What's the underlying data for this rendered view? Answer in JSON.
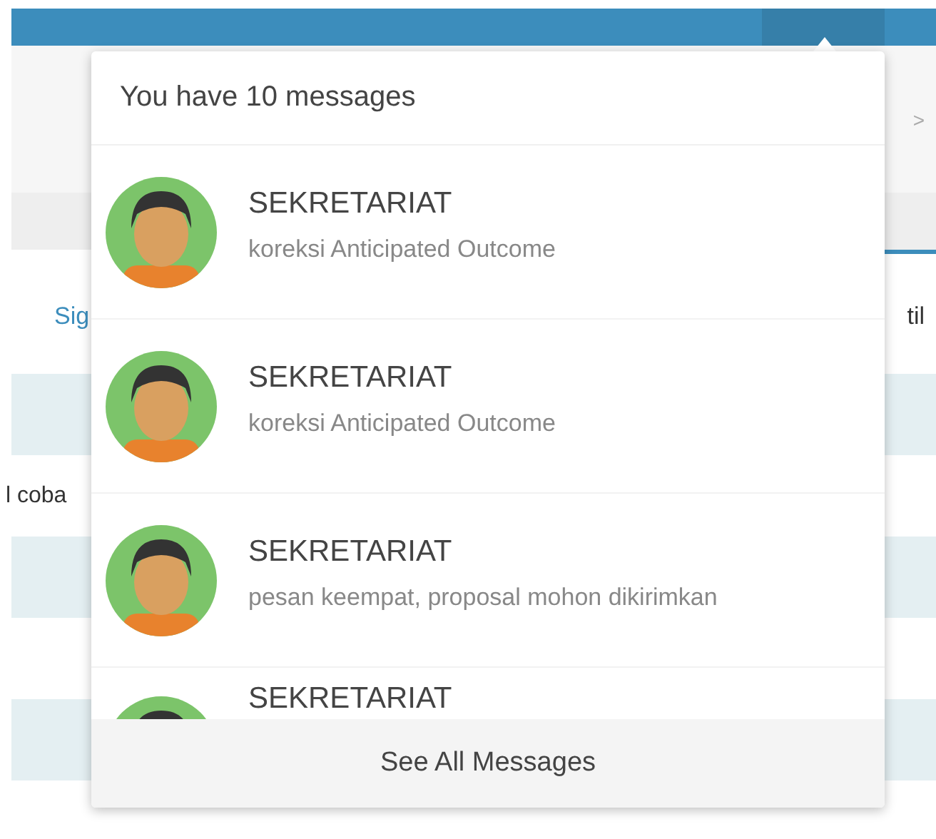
{
  "page": {
    "breadcrumb_separator": ">",
    "tabs": [
      "Sig",
      "til"
    ],
    "table_cell": "l coba"
  },
  "messages_dropdown": {
    "header": "You have 10 messages",
    "messages": [
      {
        "sender": "SEKRETARIAT",
        "preview": "koreksi Anticipated Outcome"
      },
      {
        "sender": "SEKRETARIAT",
        "preview": "koreksi Anticipated Outcome"
      },
      {
        "sender": "SEKRETARIAT",
        "preview": "pesan keempat, proposal mohon dikirimkan"
      },
      {
        "sender": "SEKRETARIAT"
      }
    ],
    "footer": "See All Messages"
  }
}
